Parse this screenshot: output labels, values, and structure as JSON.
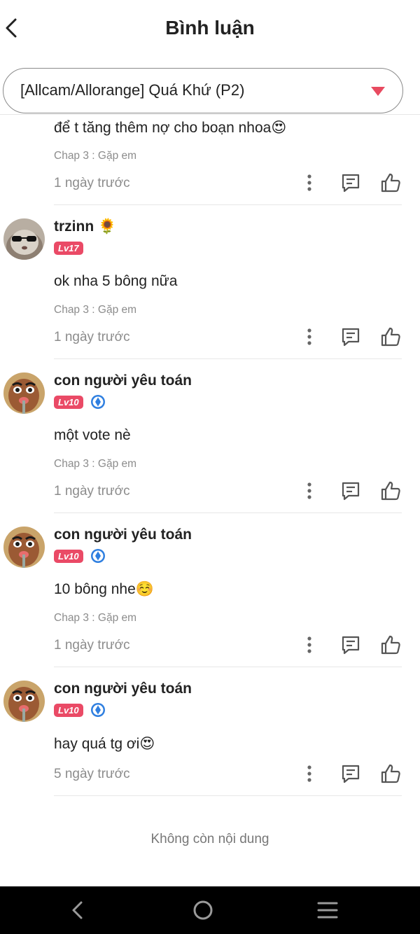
{
  "header": {
    "title": "Bình luận"
  },
  "selector": {
    "label": "[Allcam/Allorange] Quá Khứ (P2)",
    "arrow_color": "#e84a60"
  },
  "colors": {
    "level_badge": "#ea4a66",
    "verified": "#2f7fe0"
  },
  "comments": [
    {
      "user": "",
      "text": "để t tăng thêm nợ cho boạn nhoa😍",
      "chapter": "Chap 3 : Gặp em",
      "time": "1 ngày trước"
    },
    {
      "user": "trzinn 🌻",
      "level": "Lv17",
      "avatar_icon": "cat-with-sunglasses-avatar",
      "verified": false,
      "text": "ok nha 5 bông nữa",
      "chapter": "Chap 3 : Gặp em",
      "time": "1 ngày trước"
    },
    {
      "user": "con người yêu toán",
      "level": "Lv10",
      "avatar_icon": "cartoon-face-avatar",
      "verified": true,
      "text": "một vote nè",
      "chapter": "Chap 3 : Gặp em",
      "time": "1 ngày trước"
    },
    {
      "user": "con người yêu toán",
      "level": "Lv10",
      "avatar_icon": "cartoon-face-avatar",
      "verified": true,
      "text": "10 bông nhe☺️",
      "chapter": "Chap 3 : Gặp em",
      "time": "1 ngày trước"
    },
    {
      "user": "con người yêu toán",
      "level": "Lv10",
      "avatar_icon": "cartoon-face-avatar",
      "verified": true,
      "text": "hay quá tg ơi😍",
      "time": "5 ngày trước"
    }
  ],
  "footer": {
    "end_text": "Không còn nội dung"
  },
  "icons": {
    "back": "chevron-left-icon",
    "more": "more-vertical-icon",
    "reply": "comment-icon",
    "like": "thumbs-up-icon"
  },
  "navbar": {
    "back": "nav-back-icon",
    "home": "nav-home-icon",
    "menu": "nav-menu-icon"
  }
}
